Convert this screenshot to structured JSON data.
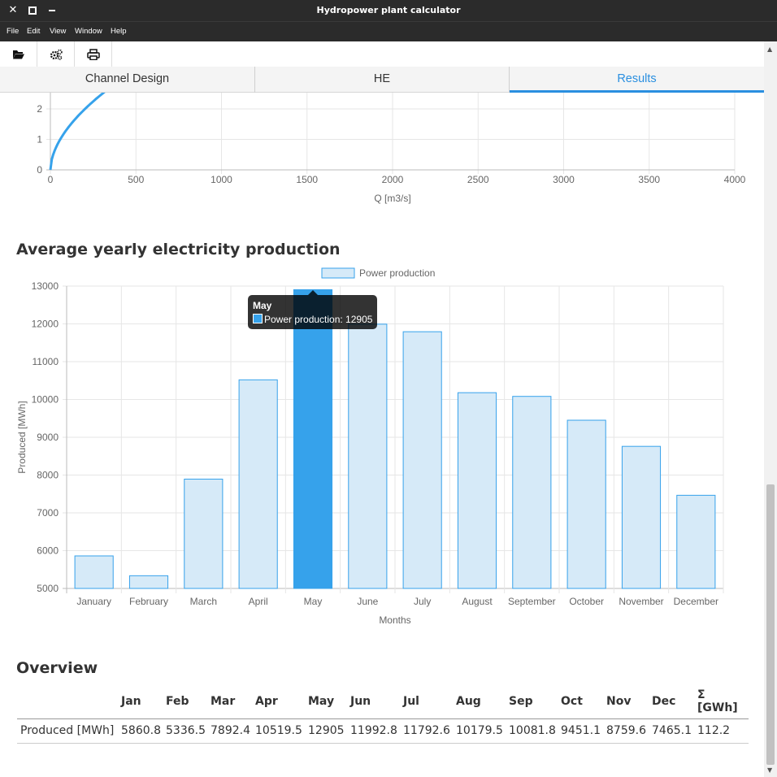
{
  "window": {
    "title": "Hydropower plant calculator",
    "close_icon": "close-icon",
    "maximize_icon": "maximize-icon",
    "minimize_icon": "minimize-icon"
  },
  "menu": {
    "items": [
      "File",
      "Edit",
      "View",
      "Window",
      "Help"
    ]
  },
  "toolbar": {
    "icons": [
      "folder-open-icon",
      "settings-gears-icon",
      "print-icon"
    ]
  },
  "tabs": [
    {
      "label": "Channel Design",
      "active": false
    },
    {
      "label": "HE",
      "active": false
    },
    {
      "label": "Results",
      "active": true
    }
  ],
  "top_chart": {
    "xlabel": "Q [m3/s]",
    "x_ticks": [
      "0",
      "500",
      "1000",
      "1500",
      "2000",
      "2500",
      "3000",
      "3500",
      "4000"
    ],
    "y_ticks_visible": [
      "0",
      "1",
      "2"
    ],
    "curve_color": "#36a2eb"
  },
  "production_section": {
    "title": "Average yearly electricity production"
  },
  "chart_data": {
    "type": "bar",
    "title": "",
    "legend": {
      "label": "Power production",
      "position": "top"
    },
    "xlabel": "Months",
    "ylabel": "Produced [MWh]",
    "ylim": [
      5000,
      13000
    ],
    "y_ticks": [
      5000,
      6000,
      7000,
      8000,
      9000,
      10000,
      11000,
      12000,
      13000
    ],
    "categories": [
      "January",
      "February",
      "March",
      "April",
      "May",
      "June",
      "July",
      "August",
      "September",
      "October",
      "November",
      "December"
    ],
    "series": [
      {
        "name": "Power production",
        "values": [
          5860.8,
          5336.5,
          7892.4,
          10519.5,
          12905,
          11992.8,
          11792.6,
          10179.5,
          10081.8,
          9451.1,
          8759.6,
          7465.1
        ]
      }
    ],
    "highlighted_index": 4,
    "bar_fill": "#d6eaf8",
    "bar_stroke": "#36a2eb",
    "highlight_fill": "#36a2eb",
    "grid": true
  },
  "tooltip": {
    "title": "May",
    "text": "Power production: 12905"
  },
  "overview": {
    "title": "Overview",
    "headers": [
      "",
      "Jan",
      "Feb",
      "Mar",
      "Apr",
      "May",
      "Jun",
      "Jul",
      "Aug",
      "Sep",
      "Oct",
      "Nov",
      "Dec",
      "Σ [GWh]"
    ],
    "rows": [
      [
        "Produced [MWh]",
        "5860.8",
        "5336.5",
        "7892.4",
        "10519.5",
        "12905",
        "11992.8",
        "11792.6",
        "10179.5",
        "10081.8",
        "9451.1",
        "8759.6",
        "7465.1",
        "112.2"
      ]
    ]
  }
}
